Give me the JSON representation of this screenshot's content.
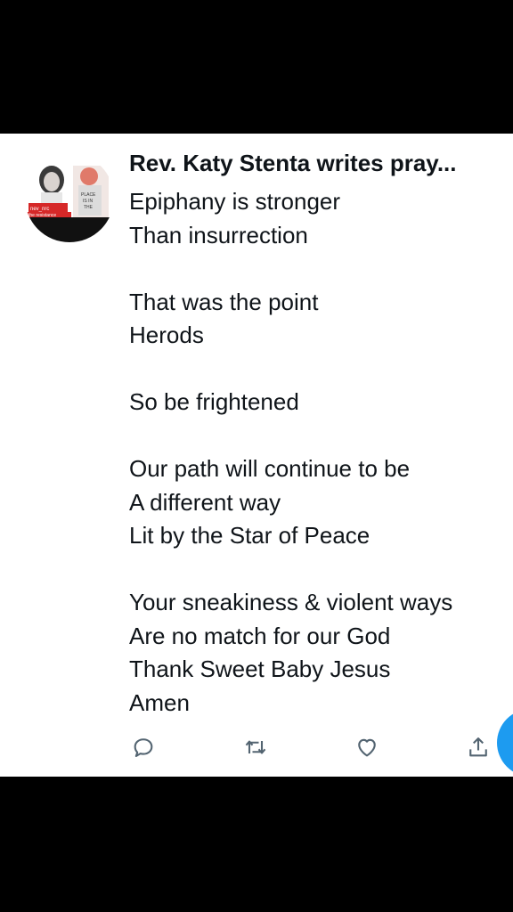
{
  "tweet": {
    "author_name": "Rev. Katy Stenta writes pray...",
    "avatar_text": "the resistance",
    "lines": [
      "Epiphany is stronger",
      "Than insurrection",
      "",
      "That was the point",
      "Herods",
      "",
      "So be frightened",
      "",
      "Our path will continue to be",
      "A different way",
      "Lit by the Star of Peace",
      "",
      "Your sneakiness & violent ways",
      "Are no match for our God",
      "Thank Sweet Baby Jesus",
      "Amen"
    ]
  },
  "actions": {
    "reply_icon": "reply-icon",
    "retweet_icon": "retweet-icon",
    "like_icon": "heart-icon",
    "share_icon": "share-icon"
  },
  "colors": {
    "text": "#0f1419",
    "icon": "#536471",
    "accent": "#1d9bf0",
    "background": "#ffffff",
    "letterbox": "#000000"
  }
}
